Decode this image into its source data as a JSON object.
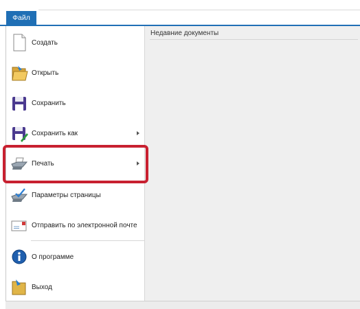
{
  "ribbon": {
    "file_tab_label": "Файл"
  },
  "menu": {
    "items": [
      {
        "label": "Создать",
        "icon": "new-document-icon",
        "has_submenu": false
      },
      {
        "label": "Открыть",
        "icon": "open-folder-icon",
        "has_submenu": false
      },
      {
        "label": "Сохранить",
        "icon": "save-floppy-icon",
        "has_submenu": false
      },
      {
        "label": "Сохранить как",
        "icon": "save-as-icon",
        "has_submenu": true
      },
      {
        "label": "Печать",
        "icon": "printer-icon",
        "has_submenu": true
      },
      {
        "label": "Параметры страницы",
        "icon": "page-setup-printer-icon",
        "has_submenu": false
      },
      {
        "label": "Отправить по электронной почте",
        "icon": "email-icon",
        "has_submenu": false
      },
      {
        "label": "О программе",
        "icon": "info-icon",
        "has_submenu": false
      },
      {
        "label": "Выход",
        "icon": "exit-icon",
        "has_submenu": false
      }
    ]
  },
  "recent": {
    "title": "Недавние документы"
  },
  "colors": {
    "accent": "#1f6fb5",
    "highlight": "#c82030",
    "panel_bg": "#efefef"
  }
}
